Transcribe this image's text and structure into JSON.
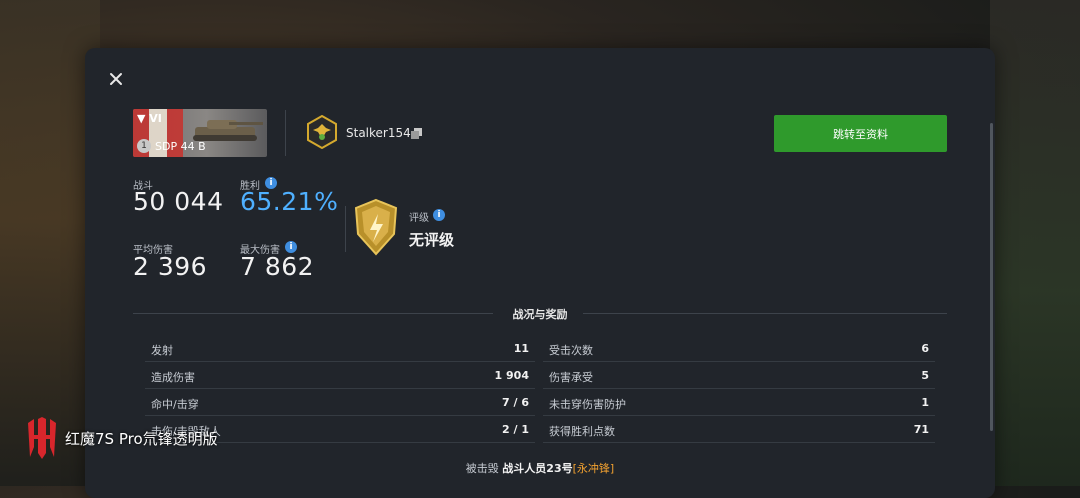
{
  "dialog": {
    "close_icon": "close-icon",
    "tank": {
      "tier": "▼ VI",
      "level": "1",
      "name": "SDP 44 B"
    },
    "player": {
      "name": "Stalker154",
      "clan_icon": "eagle-emblem-icon",
      "copy_icon": "copy-icon"
    },
    "profile_button_label": "跳转至资料",
    "stats": {
      "battles_label": "战斗",
      "battles_value": "50 044",
      "winrate_label": "胜利",
      "winrate_value": "65.21%",
      "avg_damage_label": "平均伤害",
      "avg_damage_value": "2 396",
      "max_damage_label": "最大伤害",
      "max_damage_value": "7 862",
      "rating_label": "评级",
      "rating_value": "无评级"
    },
    "section_title": "战况与奖励",
    "left_rows": [
      {
        "label": "发射",
        "value": "11"
      },
      {
        "label": "造成伤害",
        "value": "1 904"
      },
      {
        "label": "命中/击穿",
        "value": "7 / 6"
      },
      {
        "label": "击伤/击毁敌人",
        "value": "2 / 1"
      }
    ],
    "right_rows": [
      {
        "label": "受击次数",
        "value": "6"
      },
      {
        "label": "伤害承受",
        "value": "5"
      },
      {
        "label": "未击穿伤害防护",
        "value": "1"
      },
      {
        "label": "获得胜利点数",
        "value": "71"
      }
    ],
    "footer": {
      "prefix": "被击毁",
      "killer": "战斗人员23号",
      "tag": "[永冲锋]"
    }
  },
  "watermark": {
    "text": "红魔7S Pro氘锋透明版",
    "logo_icon": "redmagic-logo-icon"
  },
  "colors": {
    "accent_green": "#2f9a2c",
    "winrate_blue": "#4fb0ff",
    "tag_orange": "#f0a030"
  }
}
